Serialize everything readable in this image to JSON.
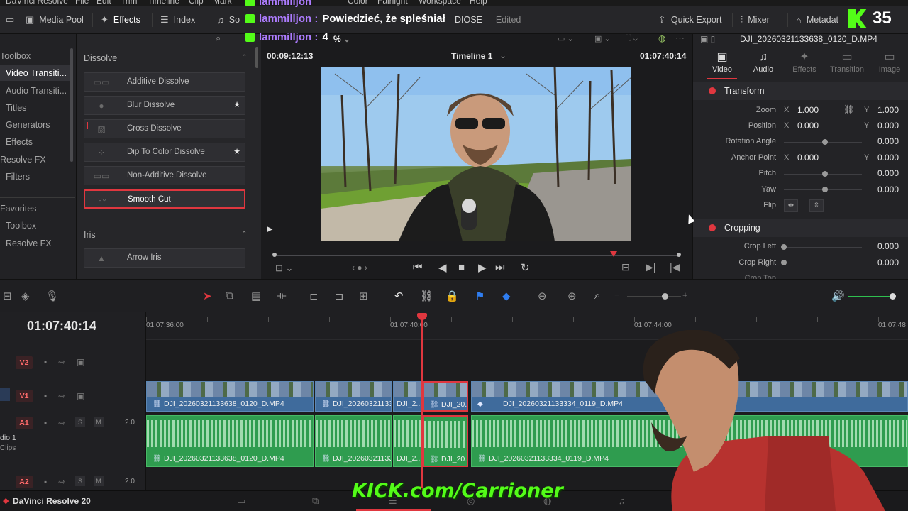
{
  "menubar": {
    "items": [
      "DaVinci Resolve",
      "File",
      "Edit",
      "Trim",
      "Timeline",
      "Clip",
      "Mark",
      "Color",
      "Fairlight",
      "Workspace",
      "Help"
    ]
  },
  "toolbar": {
    "media_pool": "Media Pool",
    "effects": "Effects",
    "index": "Index",
    "sound_library": "So",
    "project_title": "DIOSE",
    "edited": "Edited",
    "quick_export": "Quick Export",
    "mixer": "Mixer",
    "metadata": "Metadat"
  },
  "chat": {
    "lines": [
      {
        "user": "lammilljon",
        "msg": ""
      },
      {
        "user": "lammilljon :",
        "msg": "Powiedzieć, że spleśniał"
      },
      {
        "user": "lammilljon :",
        "msg": "4"
      }
    ]
  },
  "viewer_controls": {
    "zoom_percent": "%"
  },
  "effects_sidebar": {
    "items": [
      {
        "label": "Toolbox",
        "selected": false
      },
      {
        "label": "Video Transiti...",
        "selected": true
      },
      {
        "label": "Audio Transiti...",
        "selected": false
      },
      {
        "label": "Titles",
        "selected": false
      },
      {
        "label": "Generators",
        "selected": false
      },
      {
        "label": "Effects",
        "selected": false
      },
      {
        "label": "Resolve FX",
        "selected": false
      },
      {
        "label": "Filters",
        "selected": false
      },
      {
        "label": "Favorites",
        "selected": false
      },
      {
        "label": "Toolbox",
        "selected": false
      },
      {
        "label": "Resolve FX",
        "selected": false
      }
    ]
  },
  "effects_list": {
    "group_dissolve": "Dissolve",
    "group_iris": "Iris",
    "dissolve_items": [
      {
        "label": "Additive Dissolve",
        "star": false
      },
      {
        "label": "Blur Dissolve",
        "star": true
      },
      {
        "label": "Cross Dissolve",
        "star": false
      },
      {
        "label": "Dip To Color Dissolve",
        "star": true
      },
      {
        "label": "Non-Additive Dissolve",
        "star": false
      },
      {
        "label": "Smooth Cut",
        "star": false
      }
    ],
    "iris_items": [
      {
        "label": "Arrow Iris"
      }
    ]
  },
  "viewer": {
    "timecode_left": "00:09:12:13",
    "timeline_name": "Timeline 1",
    "timecode_right": "01:07:40:14"
  },
  "inspector": {
    "clip_name": "DJI_20260321133638_0120_D.MP4",
    "tabs": [
      "Video",
      "Audio",
      "Effects",
      "Transition",
      "Image"
    ],
    "transform": {
      "title": "Transform",
      "zoom_label": "Zoom",
      "zoom_x": "1.000",
      "zoom_y": "1.000",
      "position_label": "Position",
      "position_x": "0.000",
      "position_y": "0.000",
      "rotation_label": "Rotation Angle",
      "rotation": "0.000",
      "anchor_label": "Anchor Point",
      "anchor_x": "0.000",
      "anchor_y": "0.000",
      "pitch_label": "Pitch",
      "pitch": "0.000",
      "yaw_label": "Yaw",
      "yaw": "0.000",
      "flip_label": "Flip",
      "axis_x": "X",
      "axis_y": "Y"
    },
    "cropping": {
      "title": "Cropping",
      "left_label": "Crop Left",
      "left": "0.000",
      "right_label": "Crop Right",
      "right": "0.000",
      "top_label": "Crop Top"
    }
  },
  "timeline": {
    "timecode": "01:07:40:14",
    "ruler": [
      "01:07:36:00",
      "01:07:40:00",
      "01:07:44:00",
      "01:07:48"
    ],
    "tracks": {
      "v2": "V2",
      "v1": "V1",
      "a1": "A1",
      "a2": "A2",
      "a1_vol": "2.0",
      "a2_vol": "2.0",
      "audio_name": "dio 1",
      "audio_sub": "Clips",
      "solo": "S",
      "mute": "M"
    },
    "video_clips": [
      "DJI_20260321133638_0120_D.MP4",
      "DJI_20260321133...",
      "DJI_2...",
      "DJI_20...",
      "DJI_20260321133334_0119_D.MP4"
    ],
    "audio_clips": [
      "DJI_20260321133638_0120_D.MP4",
      "DJI_20260321133...",
      "DJI_2...",
      "DJI_20...",
      "DJI_20260321133334_0119_D.MP4"
    ]
  },
  "bottombar": {
    "app_name": "DaVinci Resolve 20"
  },
  "stream_overlay": {
    "kick_url": "KICK.com/Carrioner",
    "badge_number": "35"
  },
  "colors": {
    "accent_red": "#e0373f",
    "video_clip": "#3f6b9c",
    "audio_clip": "#2f9c4f",
    "kick_green": "#53fc18"
  }
}
